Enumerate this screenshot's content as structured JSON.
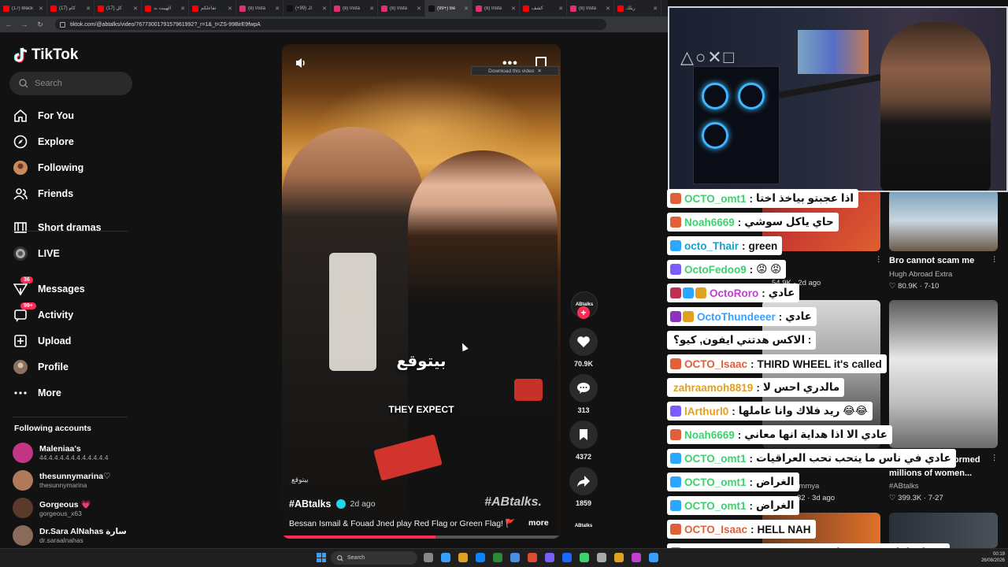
{
  "browser": {
    "tabs": [
      {
        "label": "(17) Black",
        "color": "#ff0000"
      },
      {
        "label": "(17) كام",
        "color": "#ff0000"
      },
      {
        "label": "(17) كل",
        "color": "#ff0000"
      },
      {
        "label": "الهيبت بد",
        "color": "#ff0000"
      },
      {
        "label": "تفاعلكم",
        "color": "#ff0000"
      },
      {
        "label": "(8) Insta",
        "color": "#e1306c"
      },
      {
        "label": "(+99) الـ",
        "color": "#111111"
      },
      {
        "label": "(8) Insta",
        "color": "#e1306c"
      },
      {
        "label": "(8) Insta",
        "color": "#e1306c"
      },
      {
        "label": "(99+) Be",
        "color": "#111111",
        "active": true
      },
      {
        "label": "(8) Insta",
        "color": "#e1306c"
      },
      {
        "label": "كشف",
        "color": "#ff0000"
      },
      {
        "label": "(8) Insta",
        "color": "#e1306c"
      },
      {
        "label": "ريلك",
        "color": "#ff0000"
      }
    ],
    "url": "tiktok.com/@abtalks/video/7677300179157961992?_r=1&_t=ZS-99BirE9fwpA",
    "download_banner": "Download this video"
  },
  "sidebar": {
    "logo": "TikTok",
    "search_placeholder": "Search",
    "nav": [
      {
        "label": "For You",
        "icon": "home-icon"
      },
      {
        "label": "Explore",
        "icon": "compass-icon"
      },
      {
        "label": "Following",
        "icon": "following-avatar-icon"
      },
      {
        "label": "Friends",
        "icon": "friends-icon"
      },
      {
        "label": "Short dramas",
        "icon": "film-icon"
      },
      {
        "label": "LIVE",
        "icon": "live-icon"
      },
      {
        "label": "Messages",
        "icon": "messages-icon",
        "badge": "36"
      },
      {
        "label": "Activity",
        "icon": "activity-icon",
        "badge": "99+"
      },
      {
        "label": "Upload",
        "icon": "upload-icon"
      },
      {
        "label": "Profile",
        "icon": "profile-avatar-icon"
      },
      {
        "label": "More",
        "icon": "more-icon"
      }
    ],
    "following_title": "Following accounts",
    "accounts": [
      {
        "name": "Maleniaa's",
        "handle": "44.4.4.4.4.4.4.4.4.4.4.4",
        "color": "#c13584"
      },
      {
        "name": "thesunnymarina♡",
        "handle": "thesunnymarina",
        "color": "#b07a5a"
      },
      {
        "name": "Gorgeous 💗",
        "handle": "gorgeous_x63",
        "color": "#5a3a2a"
      },
      {
        "name": "Dr.Sara AlNahas سارة",
        "handle": "dr.saraalnahas",
        "color": "#8a6a5a"
      }
    ]
  },
  "video": {
    "caption_arabic": "بيتوقع",
    "caption_english": "THEY EXPECT",
    "watermark_arabic": "بيتوقع",
    "tag": "#ABtalks.",
    "author": "#ABtalks",
    "posted": "2d ago",
    "description": "Bessan Ismail & Fouad Jned play Red Flag or Green Flag! 🚩",
    "more_label": "more",
    "progress": 0.55
  },
  "actions": {
    "creator_label": "ABtalks",
    "likes": "70.9K",
    "comments": "313",
    "saves": "4372",
    "shares": "1859",
    "disc_label": "ABtalks"
  },
  "recommendations": [
    {
      "title": "Bro cannot scam me",
      "author": "Hugh Abroad Extra",
      "likes": "80.9K",
      "date": "7-10"
    },
    {
      "title": "54.9K",
      "author": "",
      "likes": "",
      "date": "2d ago"
    },
    {
      "title": "er videos transformed millions of women...",
      "author": "#ABtalks",
      "likes": "399.3K",
      "date": "7-27"
    },
    {
      "title": "n dmammya",
      "author": "",
      "likes": "32",
      "date": "3d ago"
    }
  ],
  "chat": [
    {
      "user": "OCTO_omt1",
      "color": "#3fd06f",
      "text": "اذا عجبتو بياخذ اختا",
      "icons": [
        "#e0603a"
      ]
    },
    {
      "user": "Noah6669",
      "color": "#3fd06f",
      "text": "حاي ياكل سوشي",
      "icons": [
        "#e0603a"
      ]
    },
    {
      "user": "octo_Thair",
      "color": "#17a0c8",
      "text": "green",
      "icons": [
        "#2aa8ff"
      ]
    },
    {
      "user": "OctoFedoo9",
      "color": "#3fd06f",
      "text": "😡 😡",
      "icons": [
        "#7b5cff"
      ]
    },
    {
      "user": "OctoRoro",
      "color": "#c040d0",
      "text": "عادي",
      "icons": [
        "#c03050",
        "#2aa8ff",
        "#e0a020"
      ]
    },
    {
      "user": "OctoThundeeer",
      "color": "#3aa0ff",
      "text": "عادي",
      "icons": [
        "#9030c0",
        "#e0a020"
      ]
    },
    {
      "user": "",
      "color": "#111111",
      "text": "الاكس هدتني ايفون, كيو؟ :",
      "icons": []
    },
    {
      "user": "OCTO_Isaac",
      "color": "#e0603a",
      "text": "THIRD WHEEL it's called",
      "icons": [
        "#e0603a"
      ]
    },
    {
      "user": "zahraamoh8819",
      "color": "#e0a020",
      "text": "مالدري احس لا",
      "icons": []
    },
    {
      "user": "lArthurl0",
      "color": "#e0a020",
      "text": "ريد فلاك وانا عاملها 😂😂",
      "icons": [
        "#7b5cff"
      ]
    },
    {
      "user": "Noah6669",
      "color": "#3fd06f",
      "text": "عادي الا اذا هداية انها معاني",
      "icons": [
        "#e0603a"
      ]
    },
    {
      "user": "OCTO_omt1",
      "color": "#3fd06f",
      "text": "عادي في ناس ما يتحب تحب العراقيات",
      "icons": [
        "#2aa8ff"
      ]
    },
    {
      "user": "OCTO_omt1",
      "color": "#3fd06f",
      "text": "الغراض",
      "icons": [
        "#2aa8ff"
      ]
    },
    {
      "user": "OCTO_omt1",
      "color": "#3fd06f",
      "text": "الغراض",
      "icons": [
        "#2aa8ff"
      ]
    },
    {
      "user": "OCTO_Isaac",
      "color": "#e0603a",
      "text": "HELL NAH",
      "icons": [
        "#e0603a"
      ]
    },
    {
      "user": "Noah6669",
      "color": "#3fd06f",
      "text": "بيسان اكلت سوشي لشبعت حتى نجحت",
      "icons": [
        "#e0603a"
      ]
    }
  ],
  "taskbar": {
    "search_placeholder": "Search",
    "time": "00:19",
    "date": "26/08/2026"
  }
}
